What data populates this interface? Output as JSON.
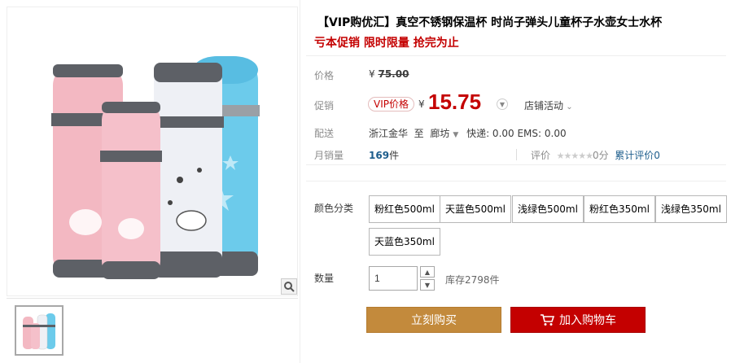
{
  "product": {
    "title": "【VIP购优汇】真空不锈钢保温杯 时尚子弹头儿童杯子水壶女士水杯",
    "promo": "亏本促销 限时限量 抢完为止"
  },
  "price": {
    "label": "价格",
    "currency": "¥",
    "original": "75.00"
  },
  "promotion": {
    "label": "促销",
    "vip_tag": "VIP价格",
    "currency": "¥",
    "price": "15.75",
    "store_activity": "店铺活动"
  },
  "shipping": {
    "label": "配送",
    "from": "浙江金华",
    "to_word": "至",
    "to": "廊坊",
    "fee": "快递: 0.00 EMS: 0.00"
  },
  "sales": {
    "label": "月销量",
    "count": "169",
    "unit": "件",
    "rating_label": "评价",
    "score": "0分",
    "reviews": "累计评价0"
  },
  "sku": {
    "color_label": "颜色分类",
    "options": [
      "粉红色500ml",
      "天蓝色500ml",
      "浅绿色500ml",
      "粉红色350ml",
      "浅绿色350ml",
      "天蓝色350ml"
    ]
  },
  "quantity": {
    "label": "数量",
    "value": "1",
    "stock": "库存2798件"
  },
  "actions": {
    "buy_now": "立刻购买",
    "add_cart": "加入购物车"
  },
  "colors": {
    "accent_red": "#c40000",
    "buy_gold": "#c38a3c",
    "pink": "#f2b3bd",
    "blue": "#5bc3e6",
    "white_bottle": "#eef0f5"
  }
}
